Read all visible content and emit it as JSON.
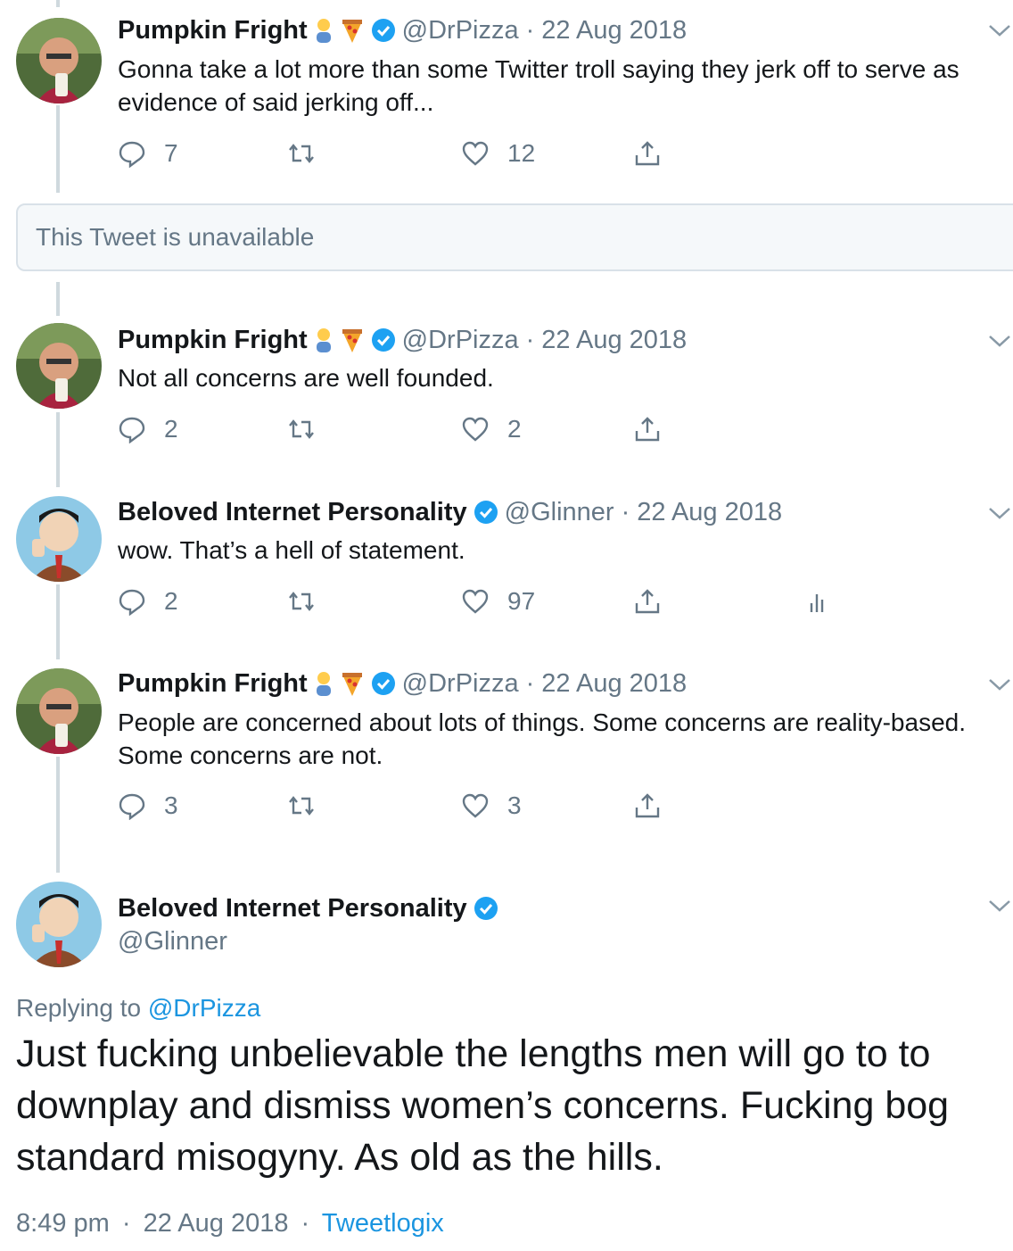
{
  "tweets": [
    {
      "name": "Pumpkin Fright",
      "handle": "@DrPizza",
      "separator": "·",
      "date": "22 Aug 2018",
      "text": "Gonna take a lot more than some Twitter troll saying they jerk off to serve as evidence of said jerking off...",
      "replies": "7",
      "retweets": "",
      "likes": "12"
    },
    {
      "name": "Pumpkin Fright",
      "handle": "@DrPizza",
      "separator": "·",
      "date": "22 Aug 2018",
      "text": "Not all concerns are well founded.",
      "replies": "2",
      "retweets": "",
      "likes": "2"
    },
    {
      "name": "Beloved Internet Personality",
      "handle": "@Glinner",
      "separator": "·",
      "date": "22 Aug 2018",
      "text": "wow. That’s a hell of statement.",
      "replies": "2",
      "retweets": "",
      "likes": "97"
    },
    {
      "name": "Pumpkin Fright",
      "handle": "@DrPizza",
      "separator": "·",
      "date": "22 Aug 2018",
      "text": "People are concerned about lots of things. Some concerns are reality-based. Some concerns are not.",
      "replies": "3",
      "retweets": "",
      "likes": "3"
    }
  ],
  "unavailable_text": "This Tweet is unavailable",
  "main_tweet": {
    "name": "Beloved Internet Personality",
    "handle": "@Glinner",
    "replying_prefix": "Replying to",
    "replying_handle": "@DrPizza",
    "text": "Just fucking unbelievable the lengths men will go to to downplay and dismiss women’s concerns. Fucking bog standard misogyny. As old as the hills.",
    "time": "8:49 pm",
    "date": "22 Aug 2018",
    "separator": "·",
    "client": "Tweetlogix"
  },
  "icons": {
    "reply": "reply-icon",
    "retweet": "retweet-icon",
    "like": "heart-icon",
    "share": "share-icon",
    "analytics": "analytics-icon",
    "verified": "verified-badge-icon",
    "caret": "chevron-down-icon"
  },
  "colors": {
    "text": "#14171a",
    "muted": "#657786",
    "link": "#1b95e0",
    "verified": "#1da1f2",
    "thread_line": "#cfd9de"
  }
}
